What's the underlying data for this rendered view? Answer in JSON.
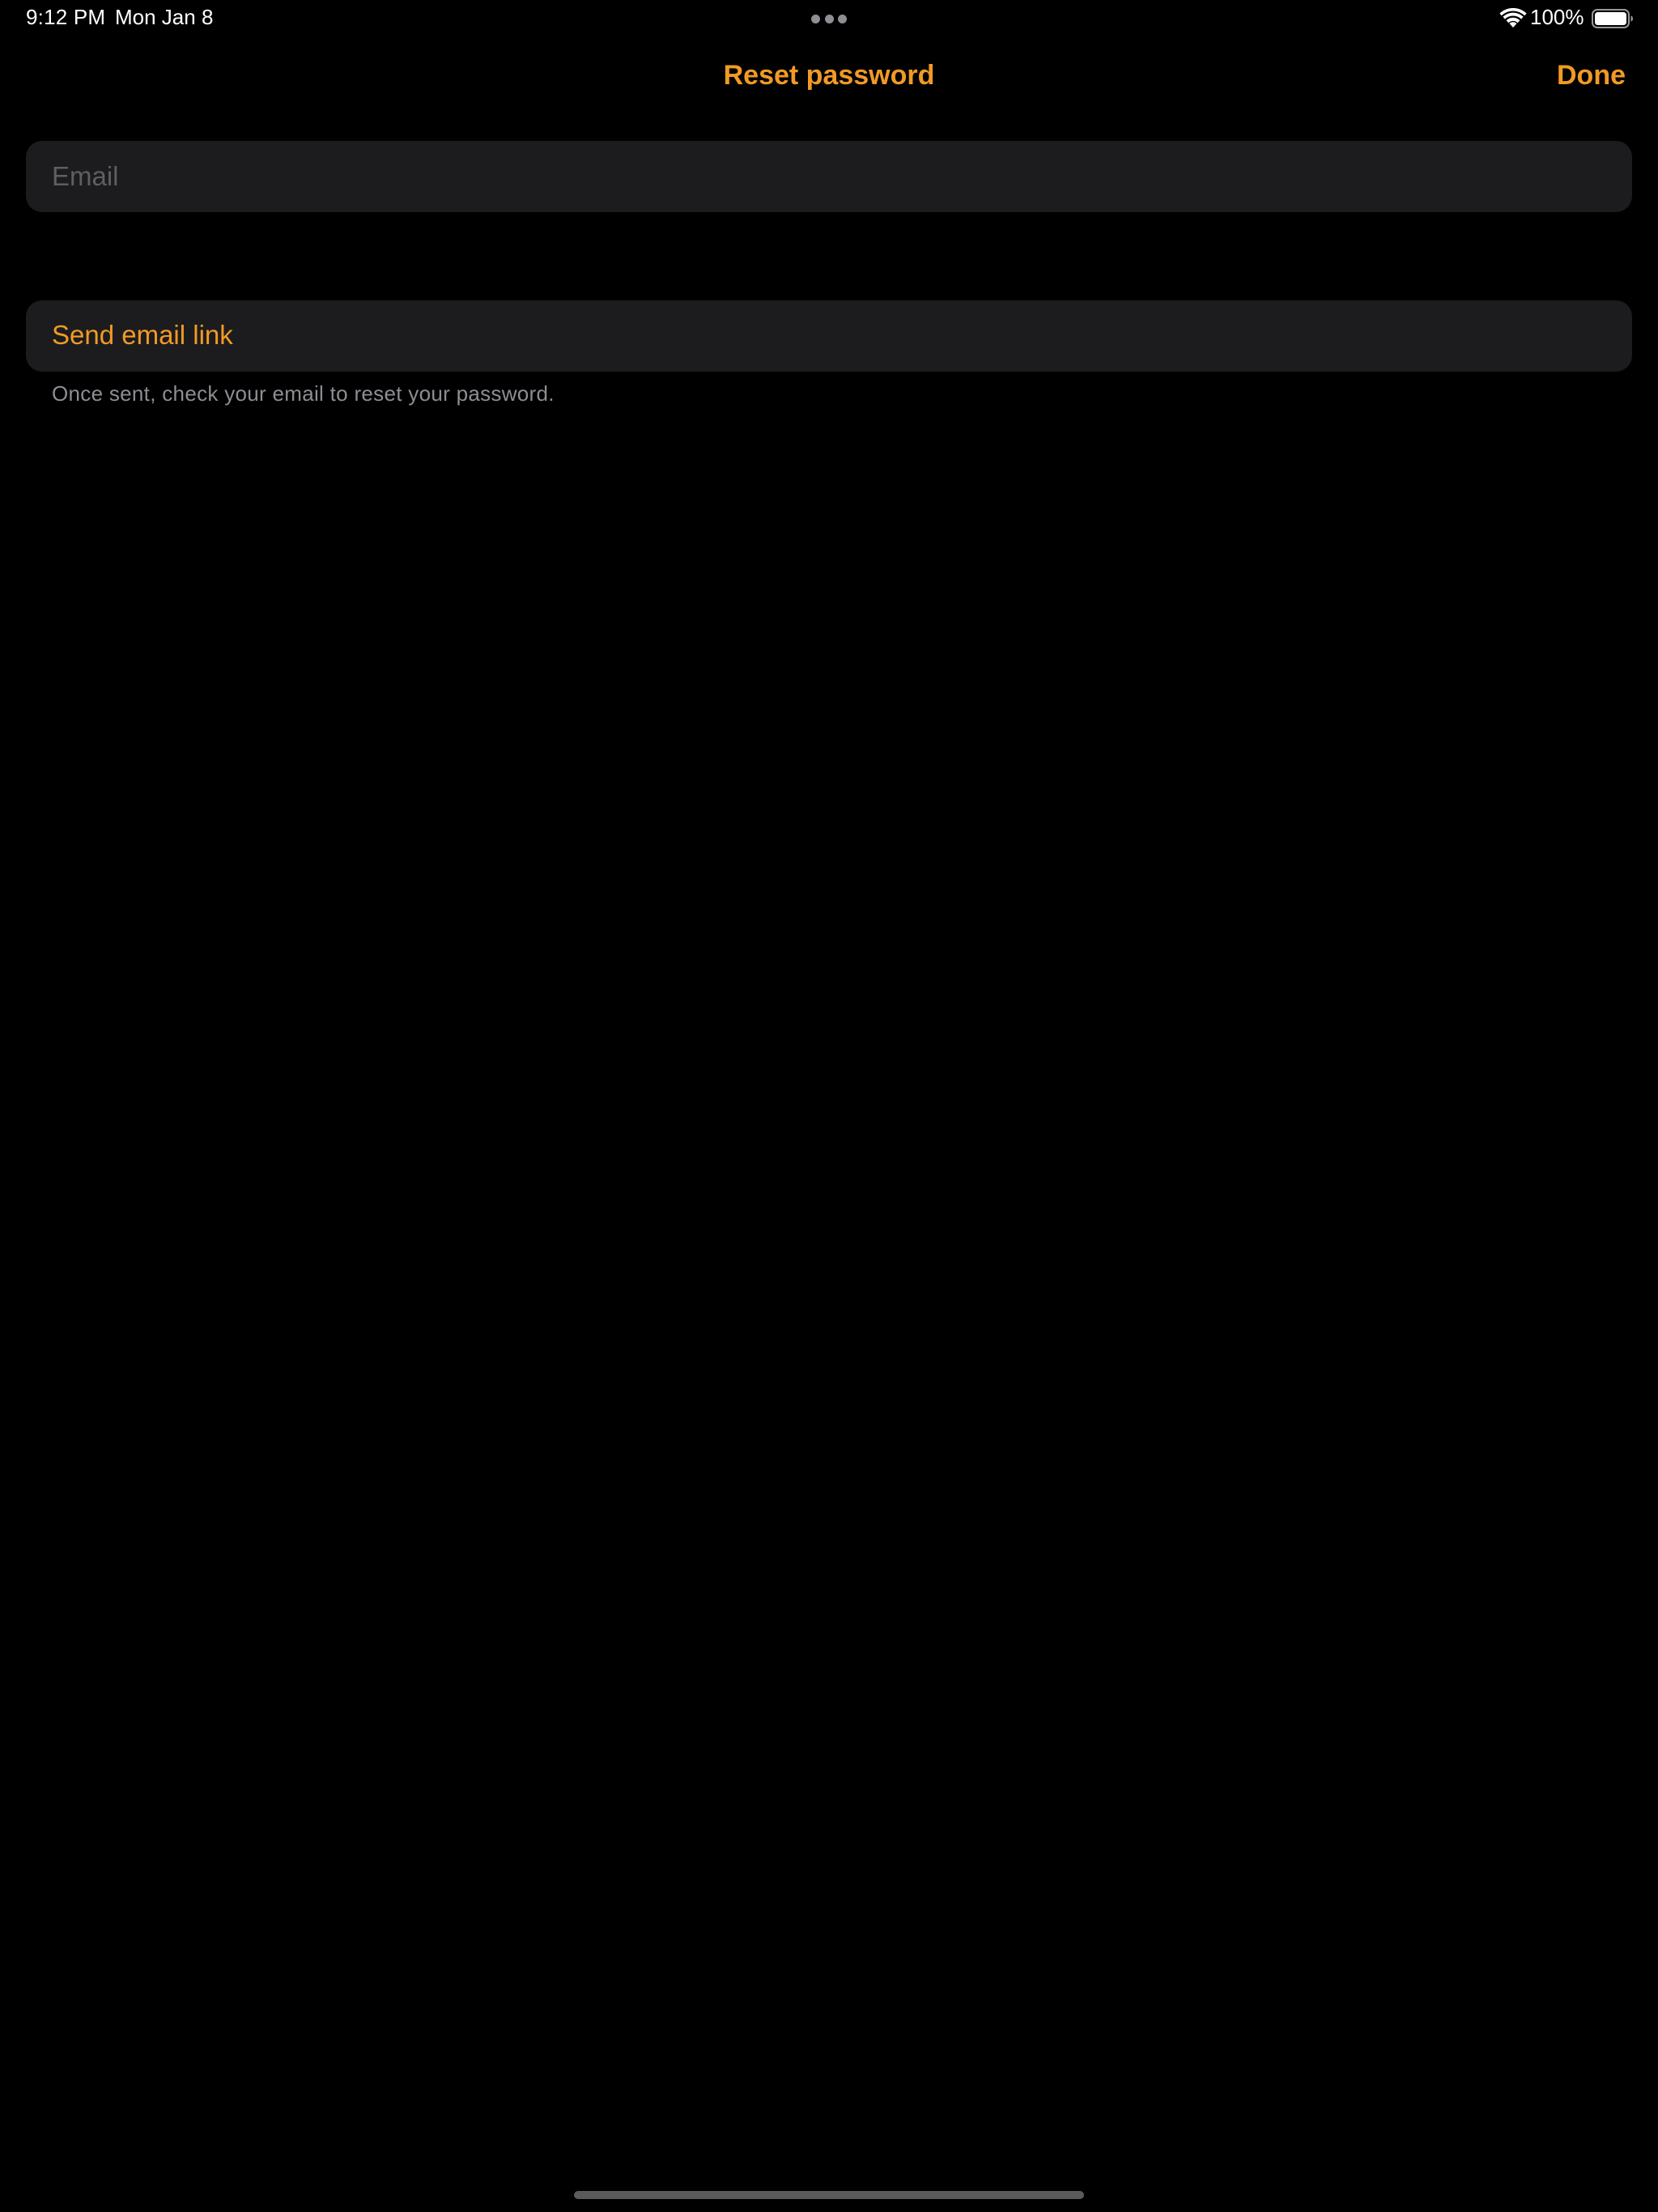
{
  "status_bar": {
    "time": "9:12 PM",
    "date": "Mon Jan 8",
    "battery_percent": "100%",
    "battery_level": 1.0,
    "icons": [
      "multitasking-dots-icon",
      "wifi-icon",
      "battery-icon"
    ]
  },
  "nav": {
    "title": "Reset password",
    "done_label": "Done"
  },
  "form": {
    "email_placeholder": "Email",
    "email_value": "",
    "send_label": "Send email link",
    "footer_note": "Once sent, check your email to reset your password."
  },
  "colors": {
    "accent": "#f19a25",
    "background": "#000000",
    "cell_background": "#1c1c1e",
    "secondary_text": "#8d8d93"
  }
}
